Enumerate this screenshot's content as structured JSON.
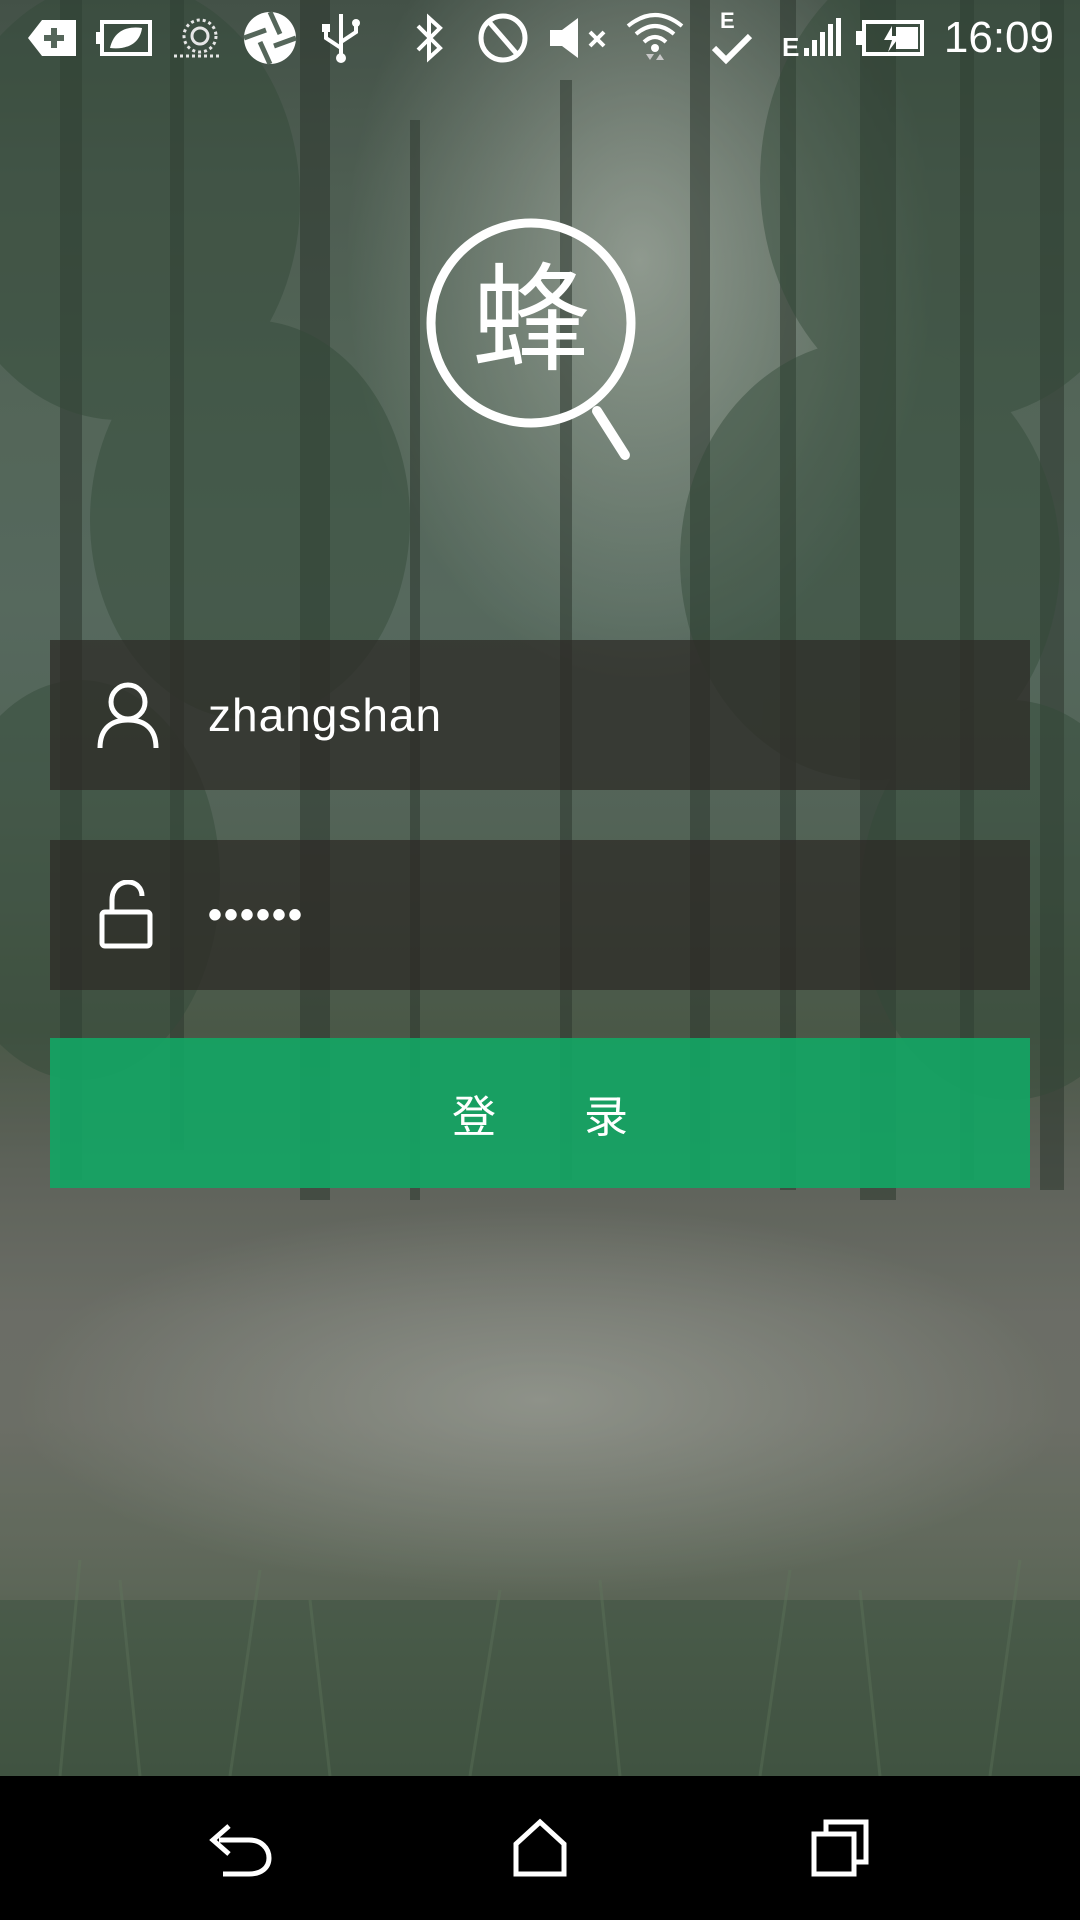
{
  "status_bar": {
    "time": "16:09",
    "network_type": "E",
    "icons": [
      "add-notification-icon",
      "battery-saver-leaf-icon",
      "snail-icon",
      "aperture-icon",
      "usb-icon",
      "bluetooth-icon",
      "do-not-disturb-icon",
      "volume-muted-icon",
      "wifi-icon",
      "edge-check-icon",
      "signal-icon",
      "battery-charging-icon"
    ]
  },
  "logo": {
    "glyph": "蜂",
    "icon": "magnifier-logo-icon"
  },
  "login_form": {
    "username": {
      "value": "zhangshan",
      "icon": "user-icon"
    },
    "password": {
      "value": "••••••",
      "icon": "unlock-icon"
    },
    "submit_label": "登　　录"
  },
  "nav_bar": {
    "buttons": [
      "back-icon",
      "home-icon",
      "recents-icon"
    ]
  },
  "colors": {
    "accent": "#14a564",
    "field_bg": "#2d2a26",
    "text": "#ffffff"
  }
}
